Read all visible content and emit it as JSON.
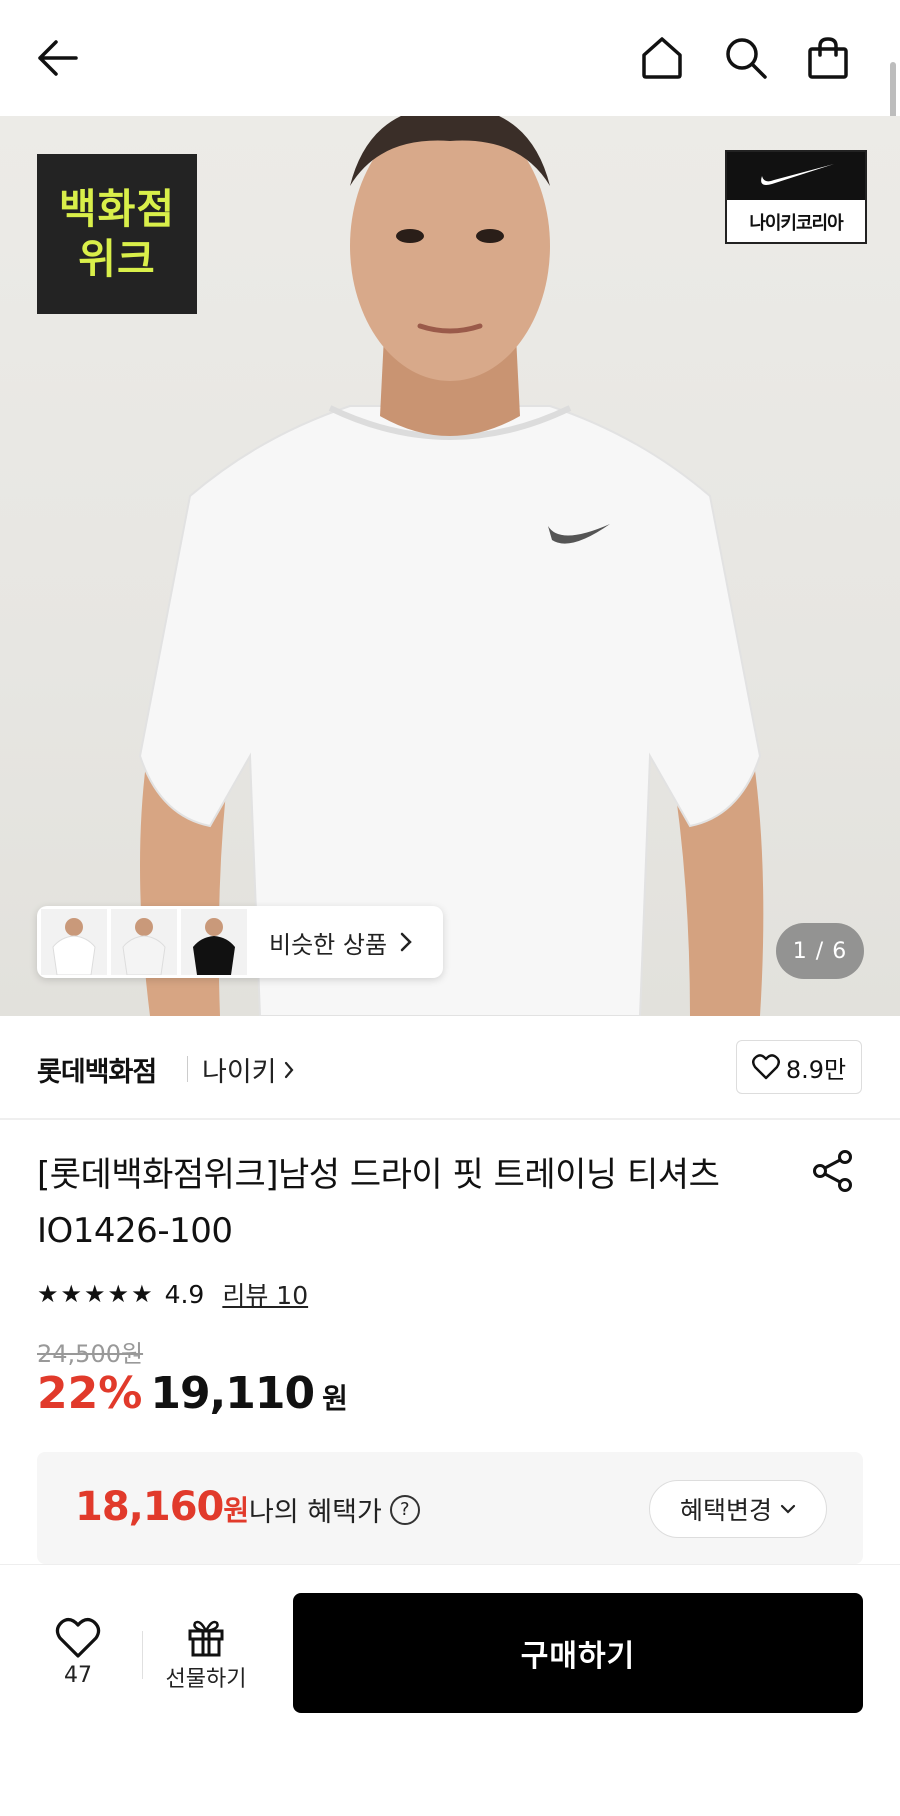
{
  "header": {
    "back_icon": "arrow-left-icon",
    "home_icon": "home-icon",
    "search_icon": "search-icon",
    "bag_icon": "shopping-bag-icon"
  },
  "hero": {
    "badge_line1": "백화점",
    "badge_line2": "위크",
    "brand_badge_text": "나이키코리아",
    "similar_label": "비슷한 상품",
    "counter": "1 / 6"
  },
  "brand": {
    "store": "롯데백화점",
    "brand_name": "나이키",
    "likes": "8.9만"
  },
  "product": {
    "title": "[롯데백화점위크]남성 드라이 핏 트레이닝 티셔츠 IO1426-100",
    "stars": "★★★★★",
    "rating": "4.9",
    "review": "리뷰 10",
    "original_price": "24,500원",
    "discount": "22%",
    "price": "19,110",
    "price_unit": "원"
  },
  "benefit": {
    "price": "18,160",
    "price_unit": "원",
    "label": "나의 혜택가",
    "help": "?",
    "button": "혜택변경"
  },
  "bottom": {
    "wish_count": "47",
    "gift_label": "선물하기",
    "buy_label": "구매하기"
  },
  "colors": {
    "accent_red": "#e13a2b",
    "badge_yellow": "#d9ef4a",
    "buy_black": "#000000"
  }
}
